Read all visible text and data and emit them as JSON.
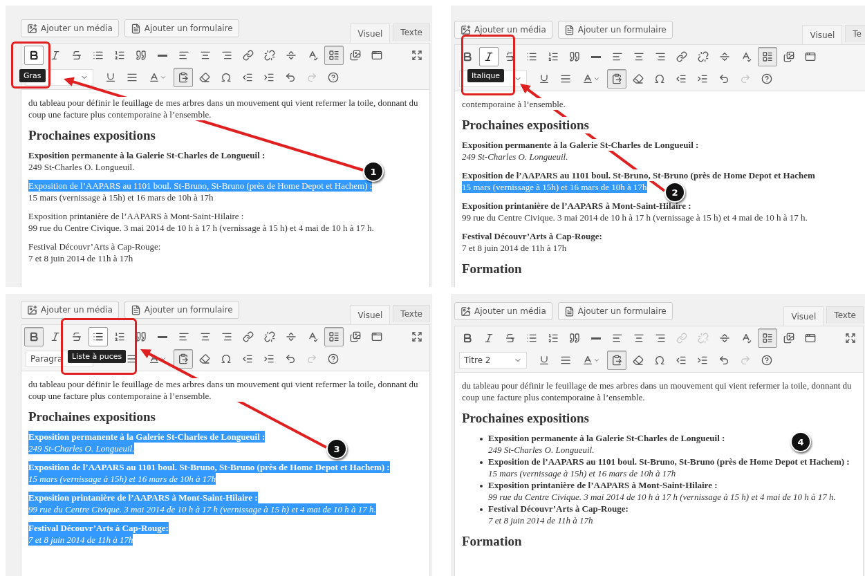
{
  "panels": [
    {
      "media_buttons": [
        "Ajouter un média",
        "Ajouter un formulaire"
      ],
      "tabs": [
        {
          "label": "Visuel",
          "selected": true
        },
        {
          "label": "Texte",
          "selected": false
        }
      ],
      "toolbar": {
        "buttons": {
          "bold": {
            "hovered": true,
            "pressed": false,
            "disabled": false
          },
          "toggle": {
            "hovered": false,
            "pressed": true,
            "disabled": false
          },
          "paste_text": {
            "hovered": false,
            "pressed": true,
            "disabled": false
          },
          "redo": {
            "hovered": false,
            "pressed": false,
            "disabled": true
          }
        },
        "fullscreen": true
      },
      "tooltip": "Gras",
      "callout": {
        "number": "1",
        "arrow": true
      },
      "content": [
        {
          "kind": "paragraph",
          "text": "du tableau pour définir le feuillage de mes arbres dans un mouvement qui vient refermer la toile, donnant du coup une facture plus contemporaine à l’ensemble."
        },
        {
          "kind": "heading",
          "text": "Prochaines expositions"
        },
        {
          "kind": "entries",
          "bulleted": false,
          "items": [
            {
              "lines": [
                {
                  "text": "Exposition permanente  à la Galerie St-Charles de Longueuil :",
                  "bold": true,
                  "italic": false,
                  "selected": false
                },
                {
                  "text": "249 St-Charles O. Longueuil.",
                  "bold": false,
                  "italic": false,
                  "selected": false
                }
              ]
            },
            {
              "lines": [
                {
                  "text": "Exposition de  l’AAPARS au 1101 boul. St-Bruno, St-Bruno (près de Home Depot et Hachem) :",
                  "bold": false,
                  "italic": false,
                  "selected": true
                },
                {
                  "text": "15 mars (vernissage à 15h) et 16 mars de 10h à 17h",
                  "bold": false,
                  "italic": false,
                  "selected": false
                }
              ]
            },
            {
              "lines": [
                {
                  "text": "Exposition printanière de l’AAPARS à Mont-Saint-Hilaire :",
                  "bold": false,
                  "italic": false,
                  "selected": false
                },
                {
                  "text": "99 rue du Centre Civique.  3 mai 2014 de 10 h à 17 h (vernissage à 15 h) et 4 mai de 10 h à 17 h.",
                  "bold": false,
                  "italic": false,
                  "selected": false
                }
              ]
            },
            {
              "lines": [
                {
                  "text": "Festival Découvr’Arts à Cap-Rouge:",
                  "bold": false,
                  "italic": false,
                  "selected": false
                },
                {
                  "text": "7 et 8 juin 2014 de 11h à 17h",
                  "bold": false,
                  "italic": false,
                  "selected": false
                }
              ]
            }
          ]
        }
      ]
    },
    {
      "media_buttons": [
        "Ajouter un média",
        "Ajouter un formulaire"
      ],
      "tabs": [
        {
          "label": "Visuel",
          "selected": true
        },
        {
          "label": "Te",
          "selected": false
        }
      ],
      "toolbar": {
        "buttons": {
          "italic": {
            "hovered": true,
            "pressed": false,
            "disabled": false
          },
          "toggle": {
            "hovered": false,
            "pressed": true,
            "disabled": false
          },
          "paste_text": {
            "hovered": false,
            "pressed": true,
            "disabled": false
          },
          "redo": {
            "hovered": false,
            "pressed": false,
            "disabled": true
          }
        },
        "fullscreen": false
      },
      "tooltip": "Italique",
      "callout": {
        "number": "2",
        "arrow": true
      },
      "content": [
        {
          "kind": "paragraph",
          "text": "contemporaine à l’ensemble."
        },
        {
          "kind": "heading",
          "text": "Prochaines expositions"
        },
        {
          "kind": "entries",
          "bulleted": false,
          "items": [
            {
              "lines": [
                {
                  "text": "Exposition permanente  à la Galerie St-Charles de Longueuil :",
                  "bold": true,
                  "italic": false,
                  "selected": false
                },
                {
                  "text": "249 St-Charles O. Longueuil.",
                  "bold": false,
                  "italic": true,
                  "selected": false
                }
              ]
            },
            {
              "lines": [
                {
                  "text": "Exposition de  l’AAPARS au 1101 boul. St-Bruno, St-Bruno (près de Home Depot et Hachem",
                  "bold": true,
                  "italic": false,
                  "selected": false
                },
                {
                  "text": "15 mars (vernissage à 15h) et 16 mars de 10h à 17h",
                  "bold": false,
                  "italic": false,
                  "selected": true
                }
              ]
            },
            {
              "lines": [
                {
                  "text": "Exposition printanière de l’AAPARS à Mont-Saint-Hilaire :",
                  "bold": true,
                  "italic": false,
                  "selected": false
                },
                {
                  "text": "99 rue du Centre Civique.  3 mai 2014 de 10 h à 17 h (vernissage à 15 h) et 4 mai de 10 h à 17 h.",
                  "bold": false,
                  "italic": false,
                  "selected": false
                }
              ]
            },
            {
              "lines": [
                {
                  "text": "Festival Découvr’Arts à Cap-Rouge:",
                  "bold": true,
                  "italic": false,
                  "selected": false
                },
                {
                  "text": "7 et 8 juin 2014 de 11h à 17h",
                  "bold": false,
                  "italic": false,
                  "selected": false
                }
              ]
            }
          ]
        },
        {
          "kind": "heading",
          "text": "Formation"
        }
      ]
    },
    {
      "media_buttons": [
        "Ajouter un média",
        "Ajouter un formulaire"
      ],
      "tabs": [
        {
          "label": "Visuel",
          "selected": true
        },
        {
          "label": "Texte",
          "selected": false
        }
      ],
      "toolbar": {
        "buttons": {
          "bold": {
            "hovered": false,
            "pressed": true,
            "disabled": false
          },
          "bullet_list": {
            "hovered": true,
            "pressed": false,
            "disabled": false
          },
          "toggle": {
            "hovered": false,
            "pressed": true,
            "disabled": false
          },
          "paste_text": {
            "hovered": false,
            "pressed": true,
            "disabled": false
          },
          "redo": {
            "hovered": false,
            "pressed": false,
            "disabled": true
          }
        },
        "fullscreen": true,
        "format": "Paragra"
      },
      "tooltip": "Liste à puces",
      "callout": {
        "number": "3",
        "arrow": true
      },
      "content": [
        {
          "kind": "paragraph",
          "text": "du tableau pour définir le feuillage de mes arbres dans un mouvement qui vient refermer la toile, donnant du coup une facture plus contemporaine à l’ensemble."
        },
        {
          "kind": "heading",
          "text": "Prochaines expositions"
        },
        {
          "kind": "entries",
          "bulleted": false,
          "items": [
            {
              "lines": [
                {
                  "text": "Exposition permanente  à la Galerie St-Charles de Longueuil :",
                  "bold": true,
                  "italic": false,
                  "selected": true
                },
                {
                  "text": "249 St-Charles O. Longueuil.",
                  "bold": false,
                  "italic": true,
                  "selected": true
                }
              ]
            },
            {
              "lines": [
                {
                  "text": "Exposition de  l’AAPARS au 1101 boul. St-Bruno, St-Bruno (près de Home Depot et Hachem) :",
                  "bold": true,
                  "italic": false,
                  "selected": true
                },
                {
                  "text": "15 mars (vernissage à 15h) et 16 mars de 10h à 17h",
                  "bold": false,
                  "italic": true,
                  "selected": true
                }
              ]
            },
            {
              "lines": [
                {
                  "text": "Exposition printanière de l’AAPARS à Mont-Saint-Hilaire :",
                  "bold": true,
                  "italic": false,
                  "selected": true
                },
                {
                  "text": "99 rue du Centre Civique.  3 mai 2014 de 10 h à 17 h (vernissage à 15 h) et 4 mai de 10 h à 17 h.",
                  "bold": false,
                  "italic": true,
                  "selected": true
                }
              ]
            },
            {
              "lines": [
                {
                  "text": "Festival Découvr’Arts à Cap-Rouge:",
                  "bold": true,
                  "italic": false,
                  "selected": true
                },
                {
                  "text": "7 et 8 juin 2014 de 11h à 17h",
                  "bold": false,
                  "italic": true,
                  "selected": true
                }
              ]
            }
          ]
        }
      ]
    },
    {
      "media_buttons": [
        "Ajouter un média",
        "Ajouter un formulaire"
      ],
      "tabs": [
        {
          "label": "Visuel",
          "selected": true
        },
        {
          "label": "Texte",
          "selected": false
        }
      ],
      "toolbar": {
        "buttons": {
          "link": {
            "hovered": false,
            "pressed": false,
            "disabled": true
          },
          "unlink": {
            "hovered": false,
            "pressed": false,
            "disabled": true
          },
          "toggle": {
            "hovered": false,
            "pressed": true,
            "disabled": false
          },
          "paste_text": {
            "hovered": false,
            "pressed": true,
            "disabled": false
          },
          "redo": {
            "hovered": false,
            "pressed": false,
            "disabled": true
          }
        },
        "fullscreen": true,
        "format": "Titre 2"
      },
      "callout": {
        "number": "4"
      },
      "content": [
        {
          "kind": "paragraph",
          "text": "du tableau pour définir le feuillage de mes arbres dans un mouvement qui vient refermer la toile, donnant du coup une facture plus contemporaine à l’ensemble."
        },
        {
          "kind": "heading",
          "text": "Prochaines expositions"
        },
        {
          "kind": "entries",
          "bulleted": true,
          "items": [
            {
              "lines": [
                {
                  "text": "Exposition permanente  à la Galerie St-Charles de Longueuil :",
                  "bold": true,
                  "italic": false,
                  "selected": false
                },
                {
                  "text": "249 St-Charles O. Longueuil.",
                  "bold": false,
                  "italic": true,
                  "selected": false
                }
              ]
            },
            {
              "lines": [
                {
                  "text": "Exposition de  l’AAPARS au 1101 boul. St-Bruno, St-Bruno (près de Home Depot et Hachem) :",
                  "bold": true,
                  "italic": false,
                  "selected": false
                },
                {
                  "text": "15 mars (vernissage à 15h) et 16 mars de 10h à 17h",
                  "bold": false,
                  "italic": true,
                  "selected": false
                }
              ]
            },
            {
              "lines": [
                {
                  "text": "Exposition printanière de l’AAPARS à Mont-Saint-Hilaire :",
                  "bold": true,
                  "italic": false,
                  "selected": false
                },
                {
                  "text": "99 rue du Centre Civique.  3 mai 2014 de 10 h à 17 h (vernissage à 15 h) et 4 mai de 10 h à 17 h.",
                  "bold": false,
                  "italic": true,
                  "selected": false
                }
              ]
            },
            {
              "lines": [
                {
                  "text": "Festival Découvr’Arts à Cap-Rouge:",
                  "bold": true,
                  "italic": false,
                  "selected": false
                },
                {
                  "text": "7 et 8 juin 2014 de 11h à 17h",
                  "bold": false,
                  "italic": true,
                  "selected": false
                }
              ]
            }
          ]
        },
        {
          "kind": "heading",
          "text": "Formation"
        }
      ]
    }
  ]
}
